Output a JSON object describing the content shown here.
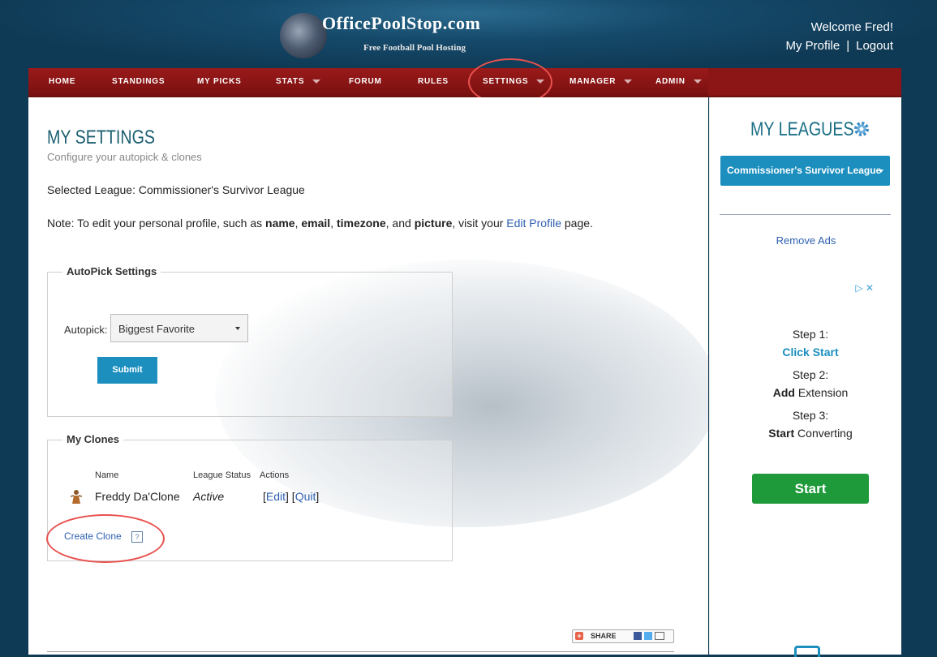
{
  "header": {
    "logo_title": "OfficePoolStop.com",
    "logo_tagline": "Free Football Pool Hosting",
    "welcome": "Welcome Fred!",
    "my_profile": "My Profile",
    "separator": "|",
    "logout": "Logout"
  },
  "nav": {
    "home": "HOME",
    "standings": "STANDINGS",
    "my_picks": "MY PICKS",
    "stats": "STATS",
    "forum": "FORUM",
    "rules": "RULES",
    "settings": "SETTINGS",
    "manager": "MANAGER",
    "admin": "ADMIN"
  },
  "page": {
    "title": "MY SETTINGS",
    "subtitle": "Configure your autopick & clones",
    "selected_league": "Selected League: Commissioner's Survivor League",
    "note": {
      "prefix": "Note: To edit your personal profile, such as ",
      "name": "name",
      "comma1": ", ",
      "email": "email",
      "comma2": ", ",
      "timezone": "timezone",
      "and": ", and ",
      "picture": "picture",
      "visit": ", visit your ",
      "link": "Edit Profile",
      "suffix": " page."
    }
  },
  "autopick": {
    "legend": "AutoPick Settings",
    "label": "Autopick:",
    "selected": "Biggest Favorite",
    "submit": "Submit"
  },
  "clones": {
    "legend": "My Clones",
    "col_name": "Name",
    "col_status": "League Status",
    "col_actions": "Actions",
    "rows": [
      {
        "name": "Freddy Da'Clone",
        "status": "Active",
        "edit": "Edit",
        "quit": "Quit"
      }
    ],
    "create": "Create Clone",
    "help": "?"
  },
  "share": {
    "label": "SHARE"
  },
  "sidebar": {
    "title": "MY LEAGUES",
    "league_button": "Commissioner's Survivor League",
    "remove_ads": "Remove Ads",
    "ad": {
      "step1_label": "Step 1:",
      "step1_action": "Click",
      "step1_word": "Start",
      "step2_label": "Step 2:",
      "step2_action": "Add",
      "step2_word": "Extension",
      "step3_label": "Step 3:",
      "step3_action": "Start",
      "step3_word": "Converting",
      "start_button": "Start"
    }
  },
  "colors": {
    "background": "#0f3a55",
    "nav_red": "#8c1515",
    "accent_blue": "#1c8fbf",
    "title_teal": "#1b5f70",
    "annotation_circle": "#e8524f",
    "ad_green": "#1f9a3a"
  }
}
